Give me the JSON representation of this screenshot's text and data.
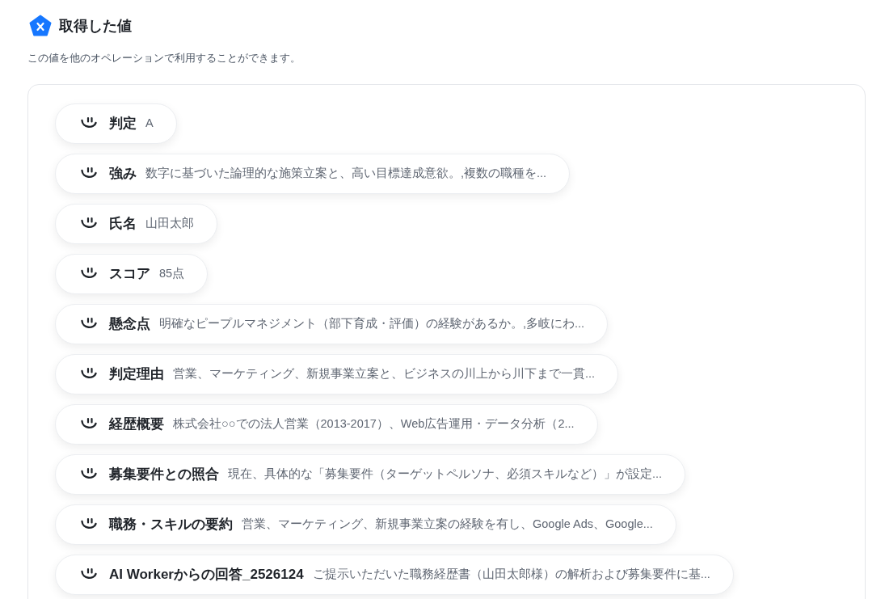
{
  "header": {
    "title": "取得した値",
    "description": "この値を他のオペレーションで利用することができます。"
  },
  "values": [
    {
      "label": "判定",
      "value": "A"
    },
    {
      "label": "強み",
      "value": "数字に基づいた論理的な施策立案と、高い目標達成意欲。,複数の職種を..."
    },
    {
      "label": "氏名",
      "value": "山田太郎"
    },
    {
      "label": "スコア",
      "value": "85点"
    },
    {
      "label": "懸念点",
      "value": "明確なピープルマネジメント（部下育成・評価）の経験があるか。,多岐にわ..."
    },
    {
      "label": "判定理由",
      "value": "営業、マーケティング、新規事業立案と、ビジネスの川上から川下まで一貫..."
    },
    {
      "label": "経歴概要",
      "value": "株式会社○○での法人営業（2013-2017）、Web広告運用・データ分析（2..."
    },
    {
      "label": "募集要件との照合",
      "value": "現在、具体的な「募集要件（ターゲットペルソナ、必須スキルなど）」が設定..."
    },
    {
      "label": "職務・スキルの要約",
      "value": "営業、マーケティング、新規事業立案の経験を有し、Google Ads、Google..."
    },
    {
      "label": "AI Workerからの回答_2526124",
      "value": "ご提示いただいた職務経歴書（山田太郎様）の解析および募集要件に基..."
    }
  ]
}
